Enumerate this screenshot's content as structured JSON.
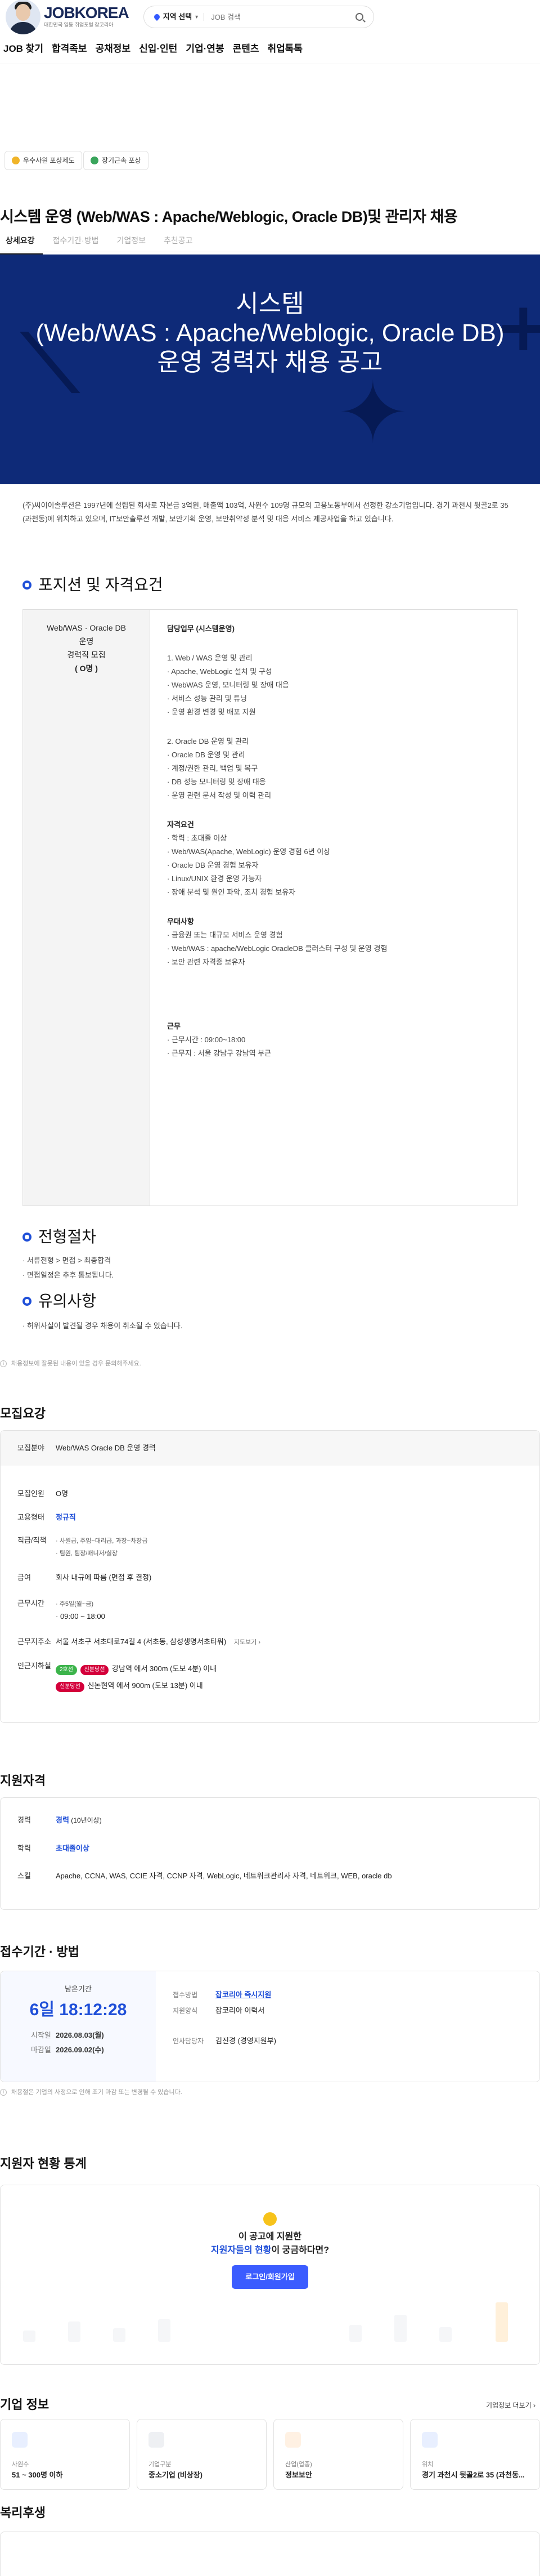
{
  "header": {
    "brand_name": "JOBKOREA",
    "brand_tagline": "대한민국 일등 취업포털 잡코리아",
    "location": "지역 선택",
    "search_placeholder": "JOB 검색"
  },
  "nav": [
    "JOB 찾기",
    "합격족보",
    "공채정보",
    "신입·인턴",
    "기업·연봉",
    "콘텐츠",
    "취업톡톡"
  ],
  "badges": [
    {
      "label": "우수사원 포상제도",
      "color": "#f0b429"
    },
    {
      "label": "장기근속 포상",
      "color": "#3aa55c"
    }
  ],
  "job": {
    "title": "시스템 운영 (Web/WAS : Apache/Weblogic, Oracle DB)및 관리자 채용",
    "tabs": [
      "상세요강",
      "접수기간·방법",
      "기업정보",
      "추천공고"
    ],
    "hero_line1": "시스템",
    "hero_line2": "(Web/WAS : Apache/Weblogic,  Oracle DB)",
    "hero_line3": "운영 경력자 채용 공고",
    "description": "(주)씨이이솔루션은 1997년에 설립된 회사로 자본금 3억원, 매출액 103억, 사원수 109명 규모의 고용노동부에서 선정한 강소기업입니다. 경기 과천시 뒷골2로 35 (과천동)에 위치하고 있으며, IT보안솔루션 개발, 보안기획 운영, 보안취약성 분석 및 대응 서비스 제공사업을 하고 있습니다."
  },
  "positions": {
    "heading": "포지션 및 자격요건",
    "left_lines": [
      "Web/WAS · Oracle DB",
      "운영",
      "경력직 모집",
      "( O명 )"
    ],
    "duty_heading": "담당업무 (시스템운영)",
    "duty_web_title": "1. Web / WAS 운영 및 관리",
    "duty_web": [
      "· Apache, WebLogic 설치 및 구성",
      "· WebWAS 운영, 모니터링 및 장애 대응",
      "· 서비스 성능 관리 및 튜닝",
      "· 운영 환경 변경 및 배포 지원"
    ],
    "duty_db_title": "2. Oracle DB 운영 및 관리",
    "duty_db": [
      "· Oracle DB 운영 및 관리",
      "· 계정/권한 관리, 백업 및 복구",
      "· DB 성능 모니터링 및 장애 대응",
      "· 운영 관련 문서 작성 및 이력 관리"
    ],
    "qual_heading": "자격요건",
    "qual": [
      "· 학력 : 초대졸 이상",
      "· Web/WAS(Apache, WebLogic) 운영 경험 6년 이상",
      "· Oracle DB 운영 경험 보유자",
      "· Linux/UNIX 환경 운영 가능자",
      "· 장애 분석 및 원인 파악, 조치 경험 보유자"
    ],
    "pref_heading": "우대사항",
    "pref": [
      "· 금융권 또는 대규모 서비스 운영 경험",
      "· Web/WAS : apache/WebLogic OracleDB 클러스터 구성 및 운영 경험",
      "· 보안 관련 자격증 보유자"
    ],
    "work_heading": "근무",
    "work": [
      "· 근무시간 : 09:00~18:00",
      "· 근무지 : 서울 강남구 강남역 부근"
    ]
  },
  "process": {
    "heading": "전형절차",
    "lines": [
      "· 서류전형 > 면접 > 최종합격",
      "· 면접일정은 추후 통보됩니다."
    ]
  },
  "caution": {
    "heading": "유의사항",
    "lines": [
      "· 허위사실이 발견될 경우 채용이 취소될 수 있습니다."
    ]
  },
  "notice": "채용정보에 잘못된 내용이 있을 경우 문의해주세요.",
  "requirements": {
    "heading": "모집요강",
    "field_key": "모집분야",
    "field_val": "Web/WAS Oracle DB 운영 경력",
    "count_key": "모집인원",
    "count_val": "O명",
    "type_key": "고용형태",
    "type_val": "정규직",
    "role_key": "직급/직책",
    "role_val1": "· 사원급, 주임~대리급, 과장~차장급",
    "role_val2": "· 팀원, 팀장/매니저/실장",
    "pay_key": "급여",
    "pay_val": "회사 내규에 따름 (면접 후 결정)",
    "time_key": "근무시간",
    "time_val1": "· 주5일(월~금)",
    "time_val2": "· 09:00 ~ 18:00",
    "addr_key": "근무지주소",
    "addr_val": "서울 서초구 서초대로74길 4 (서초동, 삼성생명서초타워)",
    "map_link": "지도보기 ›",
    "subway_key": "인근지하철",
    "subway1_line": "2호선",
    "subway1_line2": "신분당선",
    "subway1_text": "강남역 에서 300m (도보 4분) 이내",
    "subway2_line": "신분당선",
    "subway2_text": "신논현역 에서 900m (도보 13분) 이내"
  },
  "qualification": {
    "heading": "지원자격",
    "exp_key": "경력",
    "exp_val": "경력",
    "exp_sub": " (10년이상)",
    "edu_key": "학력",
    "edu_val": "초대졸이상",
    "skill_key": "스킬",
    "skill_val": "Apache, CCNA, WAS, CCIE 자격, CCNP 자격, WebLogic, 네트워크관리사 자격, 네트워크, WEB, oracle db"
  },
  "apply": {
    "heading": "접수기간 · 방법",
    "remain_label": "남은기간",
    "countdown": "6일 18:12:28",
    "start_label": "시작일",
    "start_date": "2026.08.03(월)",
    "end_label": "마감일",
    "end_date": "2026.09.02(수)",
    "method_key": "접수방법",
    "method_val": "잡코리아 즉시지원",
    "form_key": "지원양식",
    "form_val": "잡코리아 이력서",
    "contact_key": "인사담당자",
    "contact_val": "김진경 (경영지원부)",
    "notice": "채용절은 기업의 사정으로 인해 조기 마감 또는 변경될 수 있습니다."
  },
  "stats": {
    "heading": "지원자 현황 통계",
    "line1": "이 공고에 지원한",
    "line2_highlight": "지원자들의 현황",
    "line2_rest": "이 궁금하다면?",
    "button": "로그인/회원가입"
  },
  "company": {
    "heading": "기업 정보",
    "more": "기업정보 더보기 ›",
    "cards": [
      {
        "key": "사원수",
        "val": "51 ~ 300명 이하",
        "color": "#e8efff"
      },
      {
        "key": "기업구분",
        "val": "중소기업 (비상장)",
        "color": "#eef0f3"
      },
      {
        "key": "산업(업종)",
        "val": "정보보안",
        "color": "#fff1e3"
      },
      {
        "key": "위치",
        "val": "경기 과천시 뒷골2로 35 (과천동...",
        "color": "#e8efff"
      }
    ]
  },
  "welfare": {
    "heading": "복리후생"
  }
}
